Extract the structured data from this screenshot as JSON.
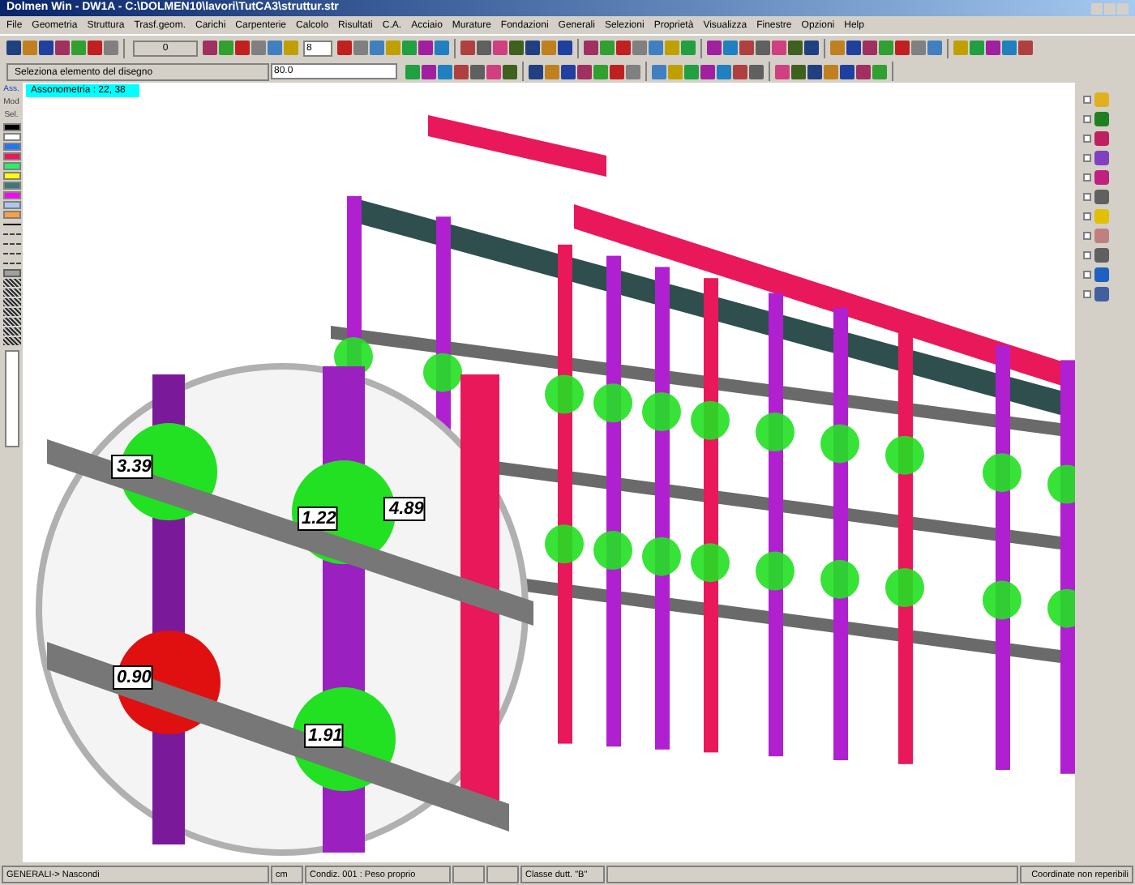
{
  "window": {
    "title": "Dolmen Win - DW1A - C:\\DOLMEN10\\lavori\\TutCA3\\struttur.str"
  },
  "menu": [
    "File",
    "Geometria",
    "Struttura",
    "Trasf.geom.",
    "Carichi",
    "Carpenterie",
    "Calcolo",
    "Risultati",
    "C.A.",
    "Acciaio",
    "Murature",
    "Fondazioni",
    "Generali",
    "Selezioni",
    "Proprietà",
    "Visualizza",
    "Finestre",
    "Opzioni",
    "Help"
  ],
  "toolbar": {
    "value_field": "0",
    "layer_field": "8"
  },
  "prompt": {
    "text": "Seleziona elemento del disegno",
    "value": "80.0"
  },
  "palette": {
    "modes": [
      {
        "label": "Ass.",
        "selected": true
      },
      {
        "label": "Mod",
        "selected": false
      },
      {
        "label": "Sel.",
        "selected": false
      }
    ],
    "colors": [
      {
        "color": "#000000"
      },
      {
        "color": "#ffffff"
      },
      {
        "color": "#1e78ff"
      },
      {
        "color": "#f0145a"
      },
      {
        "color": "#28f064"
      },
      {
        "color": "#ffff00"
      },
      {
        "color": "#3c7878"
      },
      {
        "color": "#ff00ff"
      },
      {
        "color": "#aac8f0"
      },
      {
        "color": "#ffa040"
      }
    ]
  },
  "viewport": {
    "view_label": "Assonometria : 22, 38",
    "value_labels": [
      "3.39",
      "1.22",
      "4.89",
      "0.90",
      "1.91"
    ]
  },
  "status_bar": [
    "GENERALI-> Nascondi",
    "cm",
    "Condiz. 001 : Peso proprio",
    "Classe dutt. \"B\"",
    "Coordinate non reperibili"
  ]
}
